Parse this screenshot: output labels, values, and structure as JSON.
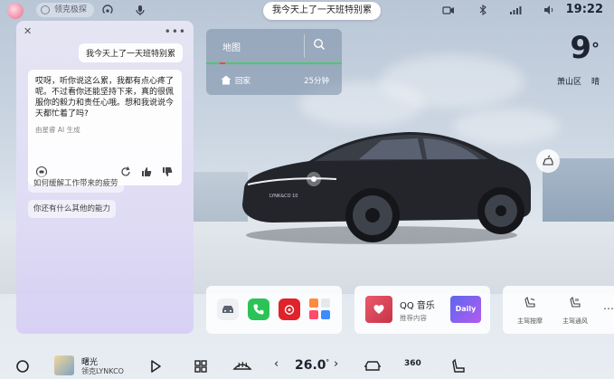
{
  "status_bar": {
    "assistant_pill": "领克极探",
    "voice_prompt": "我今天上了一天班特别累",
    "time": "19:22"
  },
  "chat": {
    "user_message": "我今天上了一天班特别累",
    "answer_text": "哎呀，听你说这么累，我都有点心疼了呢。不过看你还能坚持下来，真的很佩服你的毅力和责任心哦。想和我说说今天都忙着了吗?",
    "source": "由星睿 AI 生成",
    "suggestions": [
      "如何缓解工作带来的疲劳",
      "你还有什么其他的能力"
    ]
  },
  "map": {
    "title": "地图",
    "destination": "回家",
    "eta": "25分钟"
  },
  "weather": {
    "temperature": "9",
    "degree": "°",
    "place": "萧山区",
    "condition": "晴"
  },
  "car": {
    "badge": "LYNK&CO 10"
  },
  "music_card": {
    "app_name": "QQ 音乐",
    "subtitle": "推荐内容",
    "daily_label": "Daily"
  },
  "seat_card": {
    "items": [
      {
        "label": "主驾按摩"
      },
      {
        "label": "主驾通风"
      }
    ]
  },
  "dock": {
    "song_title": "曙光",
    "song_artist": "领克LYNKCO",
    "ac_temp": "26.0",
    "ac_unit": "°",
    "view360": "360"
  },
  "colors": {
    "chat_bg": "#e3def6",
    "map_card": "#7f93ab",
    "traffic_green": "#4cc96a",
    "traffic_red": "#e94949",
    "phone_app": "#2bc356",
    "netease_app": "#e0222b"
  }
}
